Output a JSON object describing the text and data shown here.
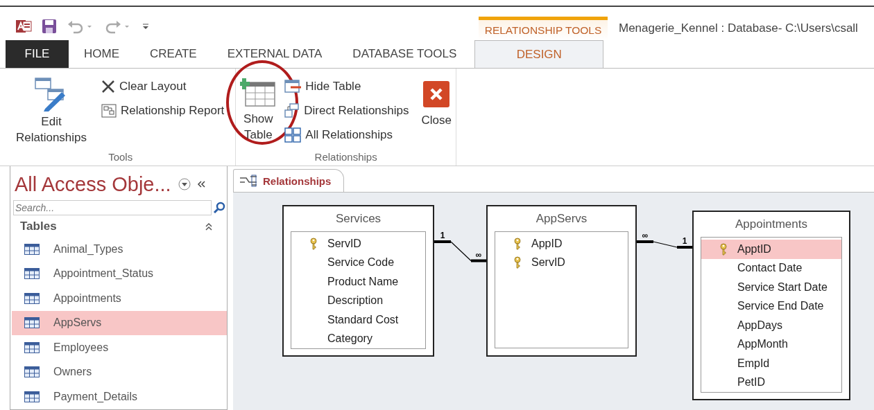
{
  "window": {
    "title": "Menagerie_Kennel : Database- C:\\Users\\csall",
    "context_group": "RELATIONSHIP TOOLS"
  },
  "tabs": [
    {
      "label": "FILE",
      "kind": "file",
      "selected": false
    },
    {
      "label": "HOME",
      "kind": "plain",
      "selected": false
    },
    {
      "label": "CREATE",
      "kind": "plain",
      "selected": false
    },
    {
      "label": "EXTERNAL DATA",
      "kind": "plain",
      "selected": false
    },
    {
      "label": "DATABASE TOOLS",
      "kind": "plain",
      "selected": false
    },
    {
      "label": "DESIGN",
      "kind": "contextual",
      "selected": true
    }
  ],
  "ribbon": {
    "groups": [
      {
        "label": "Tools",
        "buttons": [
          {
            "label": "Edit Relationships",
            "kind": "large",
            "circled": false
          },
          {
            "label": "Clear Layout",
            "kind": "small",
            "circled": false
          },
          {
            "label": "Relationship Report",
            "kind": "small",
            "circled": false
          }
        ]
      },
      {
        "label": "Relationships",
        "buttons": [
          {
            "label": "Show Table",
            "kind": "large",
            "circled": true
          },
          {
            "label": "Hide Table",
            "kind": "small",
            "circled": false
          },
          {
            "label": "Direct Relationships",
            "kind": "small",
            "circled": false
          },
          {
            "label": "All Relationships",
            "kind": "small",
            "circled": false
          },
          {
            "label": "Close",
            "kind": "large",
            "circled": false
          }
        ]
      }
    ]
  },
  "nav_pane": {
    "title": "All Access Obje...",
    "search": {
      "placeholder": "Search..."
    },
    "section": "Tables",
    "items": [
      {
        "label": "Animal_Types",
        "selected": false
      },
      {
        "label": "Appointment_Status",
        "selected": false
      },
      {
        "label": "Appointments",
        "selected": false
      },
      {
        "label": "AppServs",
        "selected": true
      },
      {
        "label": "Employees",
        "selected": false
      },
      {
        "label": "Owners",
        "selected": false
      },
      {
        "label": "Payment_Details",
        "selected": false
      }
    ]
  },
  "document_tabs": [
    {
      "label": "Relationships",
      "selected": true
    }
  ],
  "diagram": {
    "tables": [
      {
        "name": "Services",
        "fields": [
          {
            "name": "ServID",
            "key": true,
            "selected": false
          },
          {
            "name": "Service Code",
            "key": false,
            "selected": false
          },
          {
            "name": "Product Name",
            "key": false,
            "selected": false
          },
          {
            "name": "Description",
            "key": false,
            "selected": false
          },
          {
            "name": "Standard Cost",
            "key": false,
            "selected": false
          },
          {
            "name": "Category",
            "key": false,
            "selected": false
          }
        ]
      },
      {
        "name": "AppServs",
        "fields": [
          {
            "name": "AppID",
            "key": true,
            "selected": false
          },
          {
            "name": "ServID",
            "key": true,
            "selected": false
          }
        ]
      },
      {
        "name": "Appointments",
        "fields": [
          {
            "name": "ApptID",
            "key": true,
            "selected": true
          },
          {
            "name": "Contact Date",
            "key": false,
            "selected": false
          },
          {
            "name": "Service Start Date",
            "key": false,
            "selected": false
          },
          {
            "name": "Service End Date",
            "key": false,
            "selected": false
          },
          {
            "name": "AppDays",
            "key": false,
            "selected": false
          },
          {
            "name": "AppMonth",
            "key": false,
            "selected": false
          },
          {
            "name": "EmpId",
            "key": false,
            "selected": false
          },
          {
            "name": "PetID",
            "key": false,
            "selected": false
          }
        ]
      }
    ],
    "relationships": [
      {
        "from_label": "1",
        "to_label": "∞"
      },
      {
        "from_label": "∞",
        "to_label": "1"
      }
    ]
  }
}
